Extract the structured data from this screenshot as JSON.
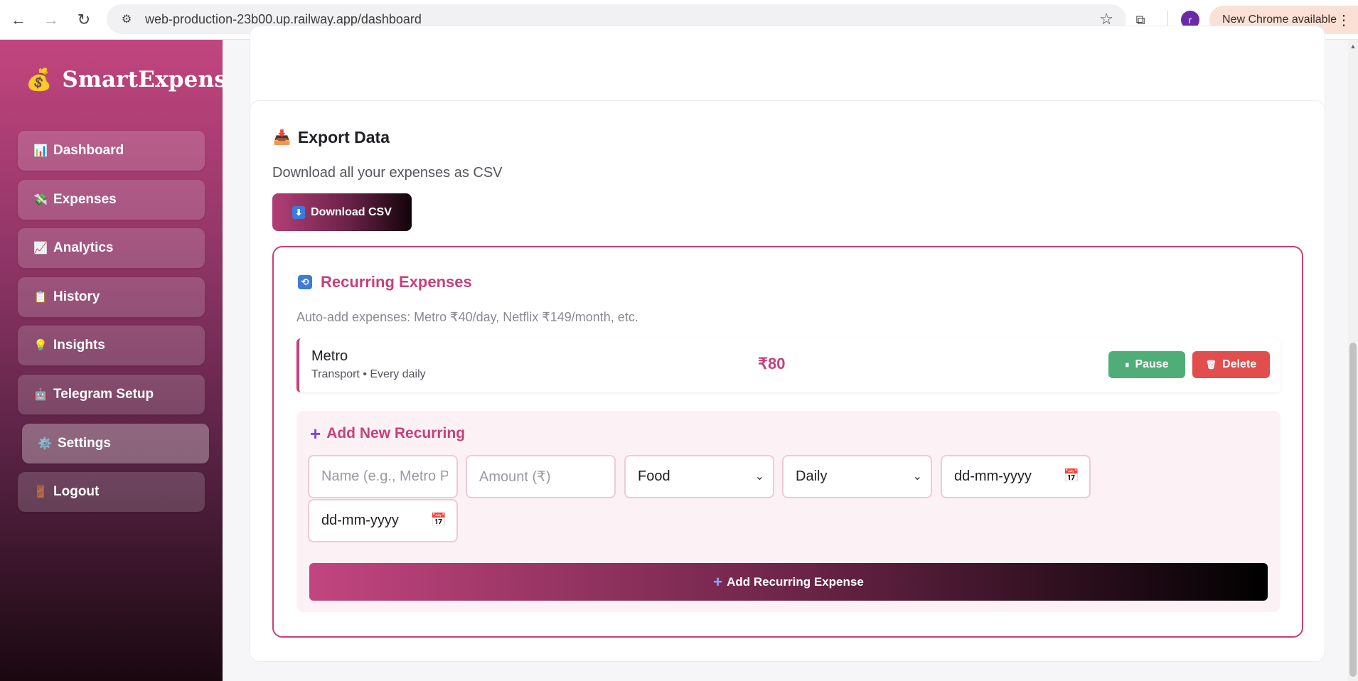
{
  "browser": {
    "url": "web-production-23b00.up.railway.app/dashboard",
    "update_label": "New Chrome available",
    "profile_initial": "r"
  },
  "sidebar": {
    "brand_icon": "money-bag-icon",
    "brand": "SmartExpense",
    "items": [
      {
        "label": "Dashboard",
        "icon": "bar-chart-icon",
        "glyph": "📊"
      },
      {
        "label": "Expenses",
        "icon": "money-wings-icon",
        "glyph": "💸"
      },
      {
        "label": "Analytics",
        "icon": "trend-up-icon",
        "glyph": "📈"
      },
      {
        "label": "History",
        "icon": "clipboard-icon",
        "glyph": "📋"
      },
      {
        "label": "Insights",
        "icon": "lightbulb-icon",
        "glyph": "💡"
      },
      {
        "label": "Telegram Setup",
        "icon": "robot-icon",
        "glyph": "🤖"
      },
      {
        "label": "Settings",
        "icon": "gear-icon",
        "glyph": "⚙️",
        "active": true
      },
      {
        "label": "Logout",
        "icon": "door-icon",
        "glyph": "🚪"
      }
    ]
  },
  "export": {
    "title": "Export Data",
    "description": "Download all your expenses as CSV",
    "button": "Download CSV"
  },
  "recurring": {
    "title": "Recurring Expenses",
    "description": "Auto-add expenses: Metro ₹40/day, Netflix ₹149/month, etc.",
    "items": [
      {
        "name": "Metro",
        "meta": "Transport • Every daily",
        "amount": "₹80",
        "pause_label": "Pause",
        "delete_label": "Delete"
      }
    ],
    "add_form": {
      "title": "Add New Recurring",
      "name_placeholder": "Name (e.g., Metro Pass,",
      "amount_placeholder": "Amount (₹)",
      "category_value": "Food",
      "frequency_value": "Daily",
      "start_date_placeholder": "dd-mm-yyyy",
      "end_date_placeholder": "dd-mm-yyyy",
      "submit_label": "Add Recurring Expense"
    }
  },
  "colors": {
    "accent": "#c93f7b",
    "pause": "#4fae78",
    "delete": "#e24d4d"
  }
}
